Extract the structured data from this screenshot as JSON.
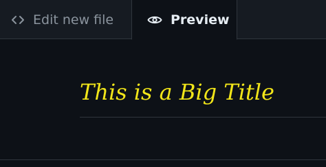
{
  "tabs": {
    "edit": {
      "label": "Edit new file",
      "icon": "code-icon"
    },
    "preview": {
      "label": "Preview",
      "icon": "eye-icon",
      "selected": true
    }
  },
  "preview": {
    "heading": "This is a Big Title",
    "heading_color": "#f2e619"
  },
  "colors": {
    "background": "#0d1117",
    "tabbar_background": "#161b22",
    "border": "#30363d",
    "inactive_text": "#8b949e",
    "active_text": "#e6edf3"
  }
}
